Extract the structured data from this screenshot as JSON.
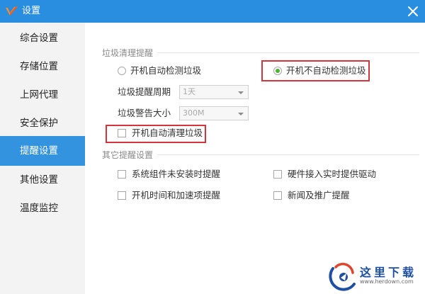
{
  "window": {
    "title": "设置"
  },
  "sidebar": {
    "items": [
      {
        "label": "综合设置"
      },
      {
        "label": "存储位置"
      },
      {
        "label": "上网代理"
      },
      {
        "label": "安全保护"
      },
      {
        "label": "提醒设置",
        "active": true
      },
      {
        "label": "其他设置"
      },
      {
        "label": "温度监控"
      }
    ]
  },
  "trash_reminder": {
    "section_title": "垃圾清理提醒",
    "radio_auto_detect": {
      "label": "开机自动检测垃圾",
      "checked": false
    },
    "radio_no_auto_detect": {
      "label": "开机不自动检测垃圾",
      "checked": true
    },
    "period": {
      "label": "垃圾提醒周期",
      "value": "1天"
    },
    "size": {
      "label": "垃圾警告大小",
      "value": "300M"
    },
    "auto_clean": {
      "label": "开机自动清理垃圾",
      "checked": false
    }
  },
  "other_reminder": {
    "section_title": "其它提醒设置",
    "options": [
      {
        "label": "系统组件未安装时提醒",
        "checked": false
      },
      {
        "label": "硬件接入实时提供驱动",
        "checked": false
      },
      {
        "label": "开机时间和加速项提醒",
        "checked": false
      },
      {
        "label": "新闻及推广提醒",
        "checked": false
      }
    ]
  },
  "watermark": {
    "brand": "这里下载",
    "url": "www.herdown.com"
  },
  "colors": {
    "titlebar": "#2a8ee0",
    "nav_active": "#3393df",
    "radio_dot": "#49b331",
    "highlight": "#d0363c"
  }
}
